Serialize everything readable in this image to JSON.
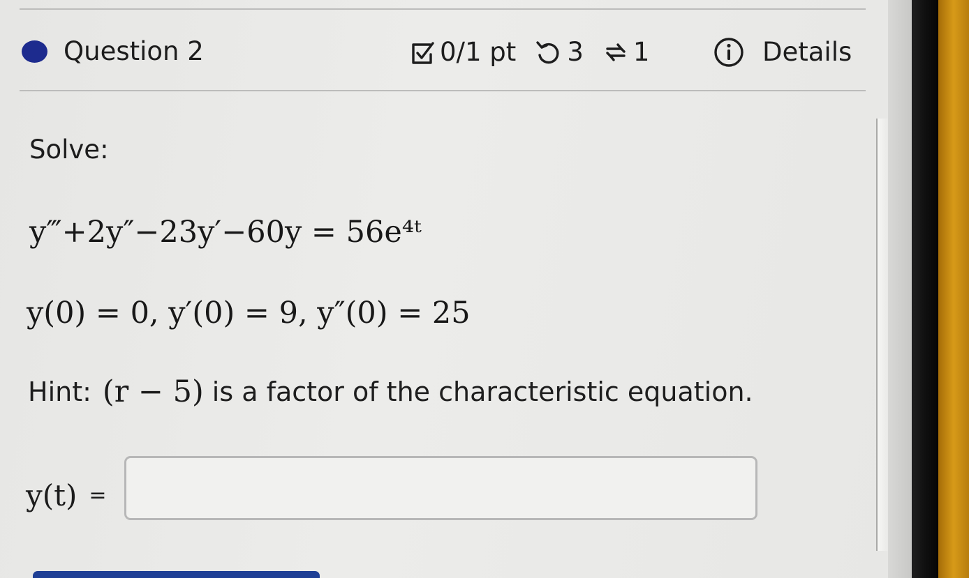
{
  "question": {
    "title": "Question 2",
    "score": "0/1 pt",
    "attempts": "3",
    "repeats": "1",
    "details_label": "Details",
    "icons": {
      "status": "status-dot-icon",
      "score": "checkbox-icon",
      "attempts": "retry-icon",
      "repeats": "repeat-icon",
      "details": "info-icon"
    }
  },
  "content": {
    "solve_label": "Solve:",
    "equation": "y‴+2y″−23y′−60y = 56e⁴ᵗ",
    "initial_conditions": "y(0) = 0,  y′(0) = 9,  y″(0) = 25",
    "hint_label": "Hint:",
    "hint_math": "(r − 5)",
    "hint_text": "is a factor of the characteristic equation."
  },
  "answer": {
    "label_math": "y(t)",
    "label_equals": "=",
    "value": "",
    "placeholder": ""
  },
  "colors": {
    "accent": "#1d2b8e",
    "button_blue": "#1f3f95",
    "text": "#1c1c1c",
    "border": "#b7b7b7"
  }
}
